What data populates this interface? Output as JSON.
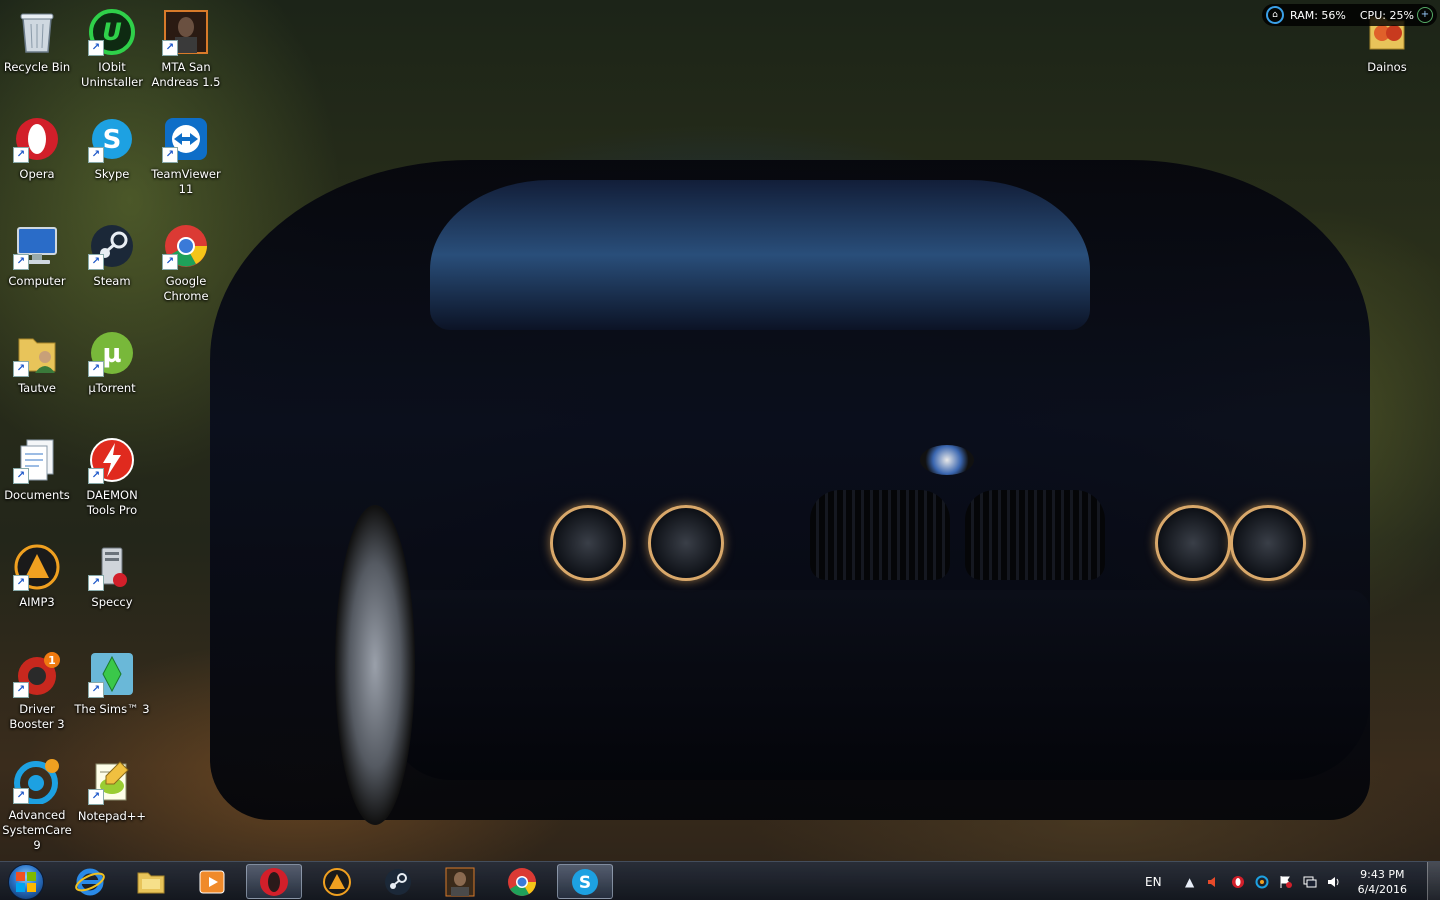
{
  "desktop_icons": [
    {
      "id": "recycle-bin",
      "label": "Recycle Bin",
      "icon": "recycle-bin-icon",
      "shortcut": false
    },
    {
      "id": "iobit",
      "label": "IObit Uninstaller",
      "icon": "iobit-uninstaller-icon",
      "shortcut": true
    },
    {
      "id": "mta",
      "label": "MTA San Andreas 1.5",
      "icon": "mta-icon",
      "shortcut": true
    },
    {
      "id": "opera",
      "label": "Opera",
      "icon": "opera-icon",
      "shortcut": true
    },
    {
      "id": "skype",
      "label": "Skype",
      "icon": "skype-icon",
      "shortcut": true
    },
    {
      "id": "teamviewer",
      "label": "TeamViewer 11",
      "icon": "teamviewer-icon",
      "shortcut": true
    },
    {
      "id": "computer",
      "label": "Computer",
      "icon": "computer-icon",
      "shortcut": true
    },
    {
      "id": "steam",
      "label": "Steam",
      "icon": "steam-icon",
      "shortcut": true
    },
    {
      "id": "chrome",
      "label": "Google Chrome",
      "icon": "chrome-icon",
      "shortcut": true
    },
    {
      "id": "tautve",
      "label": "Tautve",
      "icon": "user-folder-icon",
      "shortcut": true
    },
    {
      "id": "utorrent",
      "label": "µTorrent",
      "icon": "utorrent-icon",
      "shortcut": true
    },
    {
      "id": "documents",
      "label": "Documents",
      "icon": "documents-icon",
      "shortcut": true
    },
    {
      "id": "daemon",
      "label": "DAEMON Tools Pro",
      "icon": "daemon-tools-icon",
      "shortcut": true
    },
    {
      "id": "aimp",
      "label": "AIMP3",
      "icon": "aimp-icon",
      "shortcut": true
    },
    {
      "id": "speccy",
      "label": "Speccy",
      "icon": "speccy-icon",
      "shortcut": true
    },
    {
      "id": "driverbooster",
      "label": "Driver Booster 3",
      "icon": "driver-booster-icon",
      "shortcut": true,
      "badge": "1"
    },
    {
      "id": "sims",
      "label": "The Sims™ 3",
      "icon": "sims-icon",
      "shortcut": true
    },
    {
      "id": "asc",
      "label": "Advanced SystemCare 9",
      "icon": "advanced-systemcare-icon",
      "shortcut": true
    },
    {
      "id": "notepad",
      "label": "Notepad++",
      "icon": "notepad-plus-icon",
      "shortcut": true
    },
    {
      "id": "dainos",
      "label": "Dainos",
      "icon": "music-folder-icon",
      "shortcut": false
    }
  ],
  "widget": {
    "ram": "RAM: 56%",
    "cpu": "CPU: 25%"
  },
  "taskbar": {
    "pinned": [
      {
        "id": "ie",
        "icon": "internet-explorer-icon",
        "active": false
      },
      {
        "id": "explorer",
        "icon": "file-explorer-icon",
        "active": false
      },
      {
        "id": "media",
        "icon": "media-player-icon",
        "active": false
      },
      {
        "id": "opera",
        "icon": "opera-icon",
        "active": true
      },
      {
        "id": "aimp",
        "icon": "aimp-icon",
        "active": false
      },
      {
        "id": "steam",
        "icon": "steam-icon",
        "active": false
      },
      {
        "id": "mta",
        "icon": "mta-icon",
        "active": false
      },
      {
        "id": "chrome",
        "icon": "chrome-icon",
        "active": false
      },
      {
        "id": "skype",
        "icon": "skype-icon",
        "active": true
      }
    ],
    "tray": {
      "language": "EN",
      "time": "9:43 PM",
      "date": "6/4/2016"
    }
  },
  "colors": {
    "accent_blue": "#2b74c8",
    "opera_red": "#d21f2a",
    "skype_blue": "#1da1e2",
    "steam_navy": "#1b2838",
    "chrome_green": "#1fa15a",
    "chrome_yellow": "#f5c518",
    "chrome_red": "#db3a34"
  }
}
